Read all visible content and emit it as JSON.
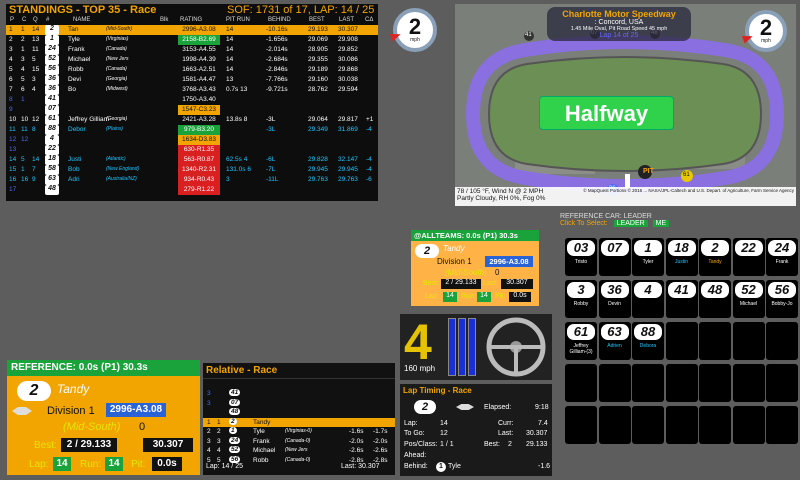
{
  "standings": {
    "title": "STANDINGS - TOP 35 - Race",
    "sof": "SOF: 1731 of 17, LAP: 14 / 25",
    "headers": [
      "P",
      "C",
      "Q",
      "#",
      "NAME",
      "Blk",
      "RATING",
      "PIT RUN",
      "BEHIND",
      "BEST",
      "LAST",
      "CΔ"
    ],
    "rows": [
      {
        "p": "1",
        "c": "1",
        "q": "14",
        "num": "2",
        "name": "Tan",
        "club": "(Mid-South)",
        "rating": "2996-A3.08",
        "pit": "14",
        "behind": "-10.16s",
        "best": "29.193",
        "last": "30.307",
        "cd": "",
        "bg": "#f2a400",
        "fg": "#111",
        "rbg": "#f2a400"
      },
      {
        "p": "2",
        "c": "2",
        "q": "13",
        "num": "1",
        "name": "Tyle",
        "club": "(Virginias)",
        "rating": "2158-B2.69",
        "pit": "14",
        "behind": "-1.656s",
        "best": "29.069",
        "last": "29.908",
        "cd": "",
        "bg": "#0d0d0d",
        "fg": "#fff",
        "rbg": "#1aa33a"
      },
      {
        "p": "3",
        "c": "1",
        "q": "11",
        "num": "24",
        "name": "Frank",
        "club": "(Canada)",
        "rating": "3153-A4.55",
        "pit": "14",
        "behind": "-2.014s",
        "best": "28.905",
        "last": "29.852",
        "cd": "",
        "bg": "#0d0d0d",
        "fg": "#fff",
        "rbg": "#0d0d0d"
      },
      {
        "p": "4",
        "c": "3",
        "q": "5",
        "num": "52",
        "name": "Michael",
        "club": "(New Jers",
        "rating": "1998-A4.39",
        "pit": "14",
        "behind": "-2.684s",
        "best": "29.355",
        "last": "30.086",
        "cd": "",
        "bg": "#0d0d0d",
        "fg": "#fff",
        "rbg": "#0d0d0d"
      },
      {
        "p": "5",
        "c": "4",
        "q": "15",
        "num": "56",
        "name": "Robb",
        "club": "(Canada)",
        "rating": "1663-A2.51",
        "pit": "14",
        "behind": "-2.846s",
        "best": "29.189",
        "last": "29.868",
        "cd": "",
        "bg": "#0d0d0d",
        "fg": "#fff",
        "rbg": "#0d0d0d"
      },
      {
        "p": "6",
        "c": "5",
        "q": "3",
        "num": "36",
        "name": "Devi",
        "club": "(Georgia)",
        "rating": "1581-A4.47",
        "pit": "13",
        "behind": "-7.766s",
        "best": "29.160",
        "last": "30.038",
        "cd": "",
        "bg": "#0d0d0d",
        "fg": "#fff",
        "rbg": "#0d0d0d"
      },
      {
        "p": "7",
        "c": "6",
        "q": "4",
        "num": "36",
        "name": "Bo",
        "club": "(Midwest)",
        "rating": "3768-A3.43",
        "pit": "0.7s 13",
        "behind": "-9.721s",
        "best": "28.762",
        "last": "29.594",
        "cd": "",
        "bg": "#0d0d0d",
        "fg": "#fff",
        "rbg": "#0d0d0d"
      },
      {
        "p": "8",
        "c": "1",
        "q": "",
        "num": "41",
        "name": "",
        "club": "",
        "rating": "1750-A3.40",
        "pit": "",
        "behind": "",
        "best": "",
        "last": "",
        "cd": "",
        "bg": "#0d0d0d",
        "fg": "#4a6cf7",
        "rbg": "#0d0d0d"
      },
      {
        "p": "9",
        "c": "",
        "q": "",
        "num": "07",
        "name": "",
        "club": "",
        "rating": "1547-C3.23",
        "pit": "",
        "behind": "",
        "best": "",
        "last": "",
        "cd": "",
        "bg": "#0d0d0d",
        "fg": "#4a6cf7",
        "rbg": "#f2a400"
      },
      {
        "p": "10",
        "c": "10",
        "q": "12",
        "num": "61",
        "name": "Jeffrey Gilliam",
        "club": "(Georgia)",
        "rating": "2421-A3.28",
        "pit": "13.8s 8",
        "behind": "-3L",
        "best": "29.064",
        "last": "29.817",
        "cd": "+1",
        "bg": "#0d0d0d",
        "fg": "#fff",
        "rbg": "#0d0d0d"
      },
      {
        "p": "11",
        "c": "11",
        "q": "8",
        "num": "88",
        "name": "Debor",
        "club": "(Plains)",
        "rating": "979-B3.20",
        "pit": "",
        "behind": "-3L",
        "best": "29.349",
        "last": "31.869",
        "cd": "-4",
        "bg": "#0d0d0d",
        "fg": "#1ec6ff",
        "rbg": "#1aa33a"
      },
      {
        "p": "12",
        "c": "12",
        "q": "",
        "num": "4",
        "name": "",
        "club": "",
        "rating": "1634-D3.83",
        "pit": "",
        "behind": "",
        "best": "",
        "last": "",
        "cd": "",
        "bg": "#0d0d0d",
        "fg": "#4a6cf7",
        "rbg": "#f2a400"
      },
      {
        "p": "13",
        "c": "",
        "q": "",
        "num": "22",
        "name": "",
        "club": "",
        "rating": "630-R1.35",
        "pit": "",
        "behind": "",
        "best": "",
        "last": "",
        "cd": "",
        "bg": "#0d0d0d",
        "fg": "#4a6cf7",
        "rbg": "#d82020"
      },
      {
        "p": "14",
        "c": "5",
        "q": "14",
        "num": "18",
        "name": "Justi",
        "club": "(Atlantic)",
        "rating": "563-R0.87",
        "pit": "62.5s 4",
        "behind": "-6L",
        "best": "29.828",
        "last": "32.147",
        "cd": "-4",
        "bg": "#0d0d0d",
        "fg": "#1ec6ff",
        "rbg": "#d82020"
      },
      {
        "p": "15",
        "c": "1",
        "q": "7",
        "num": "58",
        "name": "Bob",
        "club": "(New England)",
        "rating": "1340-R2.31",
        "pit": "131.0s 6",
        "behind": "-7L",
        "best": "29.945",
        "last": "29.945",
        "cd": "-4",
        "bg": "#0d0d0d",
        "fg": "#1ec6ff",
        "rbg": "#d82020"
      },
      {
        "p": "16",
        "c": "16",
        "q": "9",
        "num": "63",
        "name": "Adri",
        "club": "(Australia/NZ)",
        "rating": "934-R0.43",
        "pit": "3",
        "behind": "-11L",
        "best": "29.763",
        "last": "29.763",
        "cd": "-6",
        "bg": "#0d0d0d",
        "fg": "#1ec6ff",
        "rbg": "#d82020"
      },
      {
        "p": "17",
        "c": "",
        "q": "",
        "num": "48",
        "name": "",
        "club": "",
        "rating": "279-R1.22",
        "pit": "",
        "behind": "",
        "best": "",
        "last": "",
        "cd": "",
        "bg": "#0d0d0d",
        "fg": "#4a6cf7",
        "rbg": "#d82020"
      }
    ]
  },
  "gauge_left": {
    "value": "2",
    "unit": "mph"
  },
  "gauge_right": {
    "value": "2",
    "unit": "mph"
  },
  "map": {
    "track": "Charlotte Motor Speedway",
    "location": ": Concord, USA",
    "track_info": "1.45 Mile Oval, Pit Road Speed 45 mph",
    "lap": "Lap 14 of 25",
    "halfway": "Halfway",
    "pit_label": "PIT",
    "car_markers": [
      "41",
      "07",
      "48",
      "61",
      "36",
      "1"
    ],
    "weather_line1": "78 / 105 °F, Wind N @ 2 MPH",
    "weather_line2": "Partly Cloudy, RH 0%, Fog 0%",
    "copyright": "© MapQuest Portions © 2016 ... NASA/JPL-Caltech and U.S. Depart. of Agriculture, Farm Service Agency"
  },
  "reference_car": {
    "label": "REFERENCE CAR: LEADER",
    "click": "Click To Select:",
    "leader_btn": "LEADER",
    "me_btn": "ME",
    "cars": [
      {
        "num": "03",
        "label": "Tristo"
      },
      {
        "num": "07",
        "label": ""
      },
      {
        "num": "1",
        "label": "Tyler"
      },
      {
        "num": "18",
        "label": "Justin"
      },
      {
        "num": "2",
        "label": "Tandy"
      },
      {
        "num": "22",
        "label": ""
      },
      {
        "num": "24",
        "label": "Frank"
      },
      {
        "num": "3",
        "label": "Robby"
      },
      {
        "num": "36",
        "label": "Devin"
      },
      {
        "num": "4",
        "label": ""
      },
      {
        "num": "41",
        "label": ""
      },
      {
        "num": "48",
        "label": ""
      },
      {
        "num": "52",
        "label": "Michael"
      },
      {
        "num": "56",
        "label": "Bobby-Jo"
      },
      {
        "num": "61",
        "label": "Jeffrey Gilliam-(3)"
      },
      {
        "num": "63",
        "label": "Adrien"
      },
      {
        "num": "88",
        "label": "Debora"
      }
    ]
  },
  "allteams": {
    "header": "@ALLTEAMS: 0.0s (P1) 30.3s",
    "num": "2",
    "name": "Tandy",
    "division": "Division 1",
    "rating": "2996-A3.08",
    "region": "(Mid-South)",
    "region_val": "0",
    "best_label": "Best:",
    "best": "2 / 29.133",
    "last_label": "Last:",
    "last": "30.307",
    "lap_label": "Lap:",
    "lap": "14",
    "run_label": "Run:",
    "run": "14",
    "pit_label": "Pit:",
    "pit": "0.0s"
  },
  "speedo": {
    "gear": "4",
    "speed": "160 mph"
  },
  "reference": {
    "header": "REFERENCE: 0.0s (P1) 30.3s",
    "num": "2",
    "name": "Tandy",
    "division": "Division 1",
    "rating": "2996-A3.08",
    "region": "(Mid-South)",
    "region_val": "0",
    "best_label": "Best:",
    "best": "2 / 29.133",
    "last": "30.307",
    "lap_label": "Lap:",
    "lap": "14",
    "run_label": "Run:",
    "run": "14",
    "pit_label": "Pit:",
    "pit": "0.0s"
  },
  "relative": {
    "title": "Relative - Race",
    "rows": [
      {
        "pos": "3",
        "cls": "",
        "num": "41",
        "name": "",
        "club": "",
        "gap": "",
        "gap2": "",
        "color": "#4a6cf7"
      },
      {
        "pos": "3",
        "cls": "",
        "num": "07",
        "name": "",
        "club": "",
        "gap": "",
        "gap2": "",
        "color": "#4a6cf7"
      },
      {
        "pos": "",
        "cls": "",
        "num": "48",
        "name": "",
        "club": "",
        "gap": "",
        "gap2": "",
        "color": "#4a6cf7"
      },
      {
        "pos": "1",
        "cls": "1",
        "num": "2",
        "name": "Tandy",
        "club": "",
        "gap": "",
        "gap2": "",
        "color": "#f2a400"
      },
      {
        "pos": "2",
        "cls": "2",
        "num": "1",
        "name": "Tyle",
        "club": "(Virginias-0)",
        "gap": "-1.6s",
        "gap2": "-1.7s",
        "color": "#fff"
      },
      {
        "pos": "3",
        "cls": "3",
        "num": "24",
        "name": "Frank",
        "club": "(Canada-0)",
        "gap": "-2.0s",
        "gap2": "-2.0s",
        "color": "#fff"
      },
      {
        "pos": "4",
        "cls": "4",
        "num": "52",
        "name": "Michael",
        "club": "(New Jers",
        "gap": "-2.6s",
        "gap2": "-2.6s",
        "color": "#fff"
      },
      {
        "pos": "5",
        "cls": "5",
        "num": "56",
        "name": "Robb",
        "club": "(Canada-0)",
        "gap": "-2.8s",
        "gap2": "-2.8s",
        "color": "#fff"
      }
    ],
    "lap": "Lap: 14 / 25",
    "last": "Last: 30.307"
  },
  "laptiming": {
    "title": "Lap Timing - Race",
    "num": "2",
    "elapsed_label": "Elapsed:",
    "elapsed": "9:18",
    "lap_label": "Lap:",
    "lap": "14",
    "curr_label": "Curr:",
    "curr": "7.4",
    "togo_label": "To Go:",
    "togo": "12",
    "last_label": "Last:",
    "last": "30.307",
    "pos_label": "Pos/Class:",
    "pos": "1 / 1",
    "best_label": "Best:",
    "best_pos": "2",
    "best": "29.133",
    "ahead_label": "Ahead:",
    "behind_label": "Behind:",
    "behind_num": "1",
    "behind_name": "Tyle",
    "behind_gap": "-1.6"
  }
}
